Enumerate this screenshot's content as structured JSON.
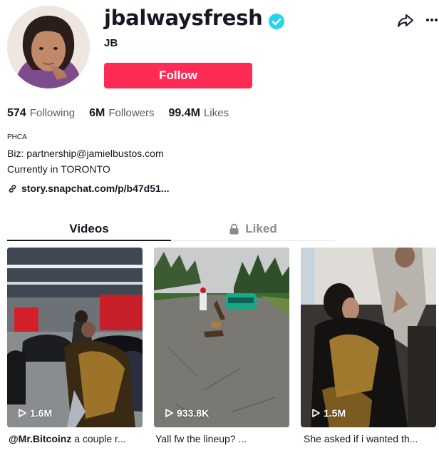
{
  "profile": {
    "username": "jbalwaysfresh",
    "nickname": "JB",
    "follow_label": "Follow",
    "verified": true
  },
  "stats": {
    "following_count": "574",
    "following_label": "Following",
    "followers_count": "6M",
    "followers_label": "Followers",
    "likes_count": "99.4M",
    "likes_label": "Likes"
  },
  "bio": {
    "line1": "PHCA",
    "line2": "Biz: partnership@jamielbustos.com",
    "line3": "Currently in TORONTO"
  },
  "link": {
    "text": "story.snapchat.com/p/b47d51..."
  },
  "tabs": [
    {
      "label": "Videos",
      "active": true
    },
    {
      "label": "Liked",
      "active": false,
      "icon": "lock-icon"
    }
  ],
  "videos": [
    {
      "views": "1.6M",
      "caption_mention": "@Mr.Bitcoinz",
      "caption_text": " a couple r..."
    },
    {
      "views": "933.8K",
      "caption_mention": "",
      "caption_text": "Yall fw the lineup? ..."
    },
    {
      "views": "1.5M",
      "caption_mention": "",
      "caption_text": "She asked if i wanted th..."
    }
  ],
  "colors": {
    "accent": "#fe2c55",
    "verified": "#20d5ec",
    "text": "#161823",
    "muted": "#5b5c63"
  },
  "icons": [
    "verified-badge-icon",
    "share-icon",
    "more-icon",
    "link-icon",
    "lock-icon",
    "play-icon"
  ]
}
